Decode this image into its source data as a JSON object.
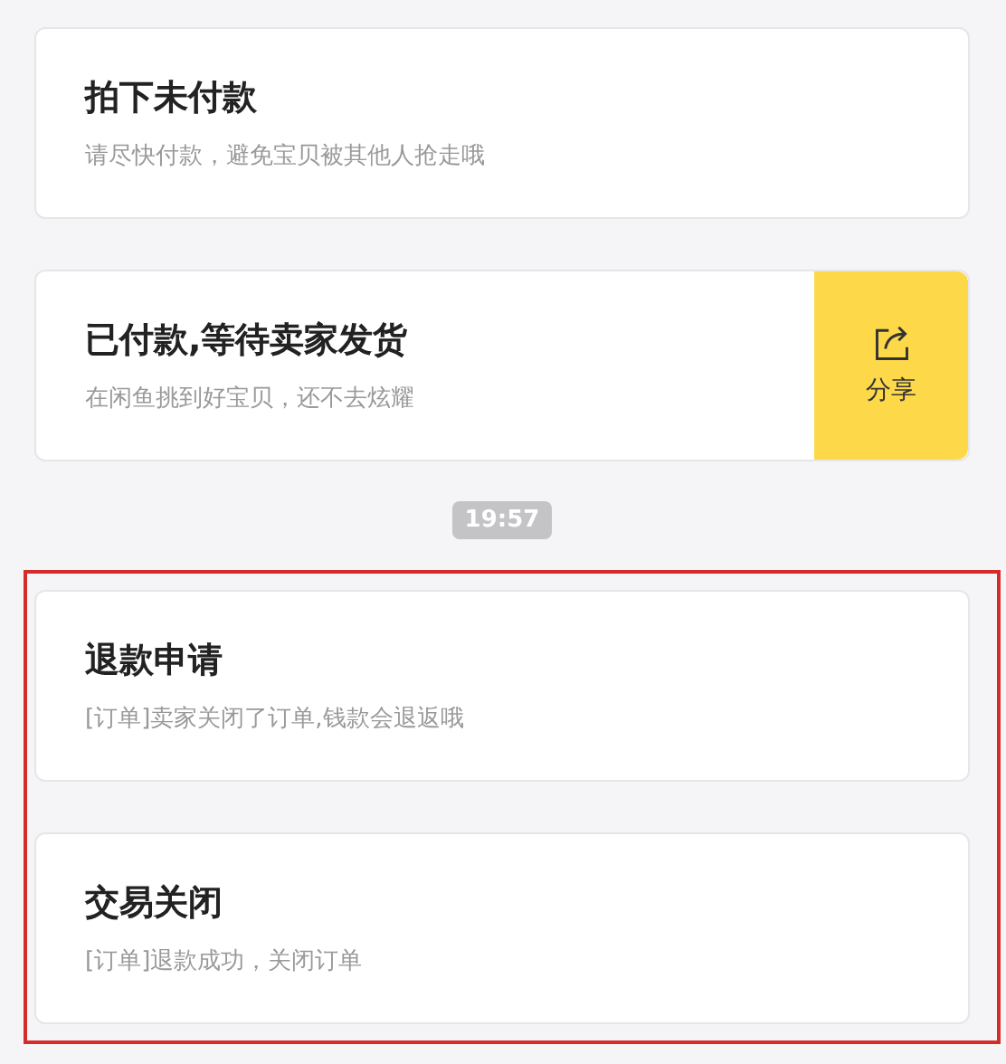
{
  "messages": [
    {
      "title": "拍下未付款",
      "subtitle": "请尽快付款，避免宝贝被其他人抢走哦"
    },
    {
      "title": "已付款,等待卖家发货",
      "subtitle": "在闲鱼挑到好宝贝，还不去炫耀",
      "action": {
        "label": "分享"
      }
    }
  ],
  "time": "19:57",
  "highlighted_messages": [
    {
      "title": "退款申请",
      "subtitle": "[订单]卖家关闭了订单,钱款会退返哦"
    },
    {
      "title": "交易关闭",
      "subtitle": "[订单]退款成功，关闭订单"
    }
  ]
}
